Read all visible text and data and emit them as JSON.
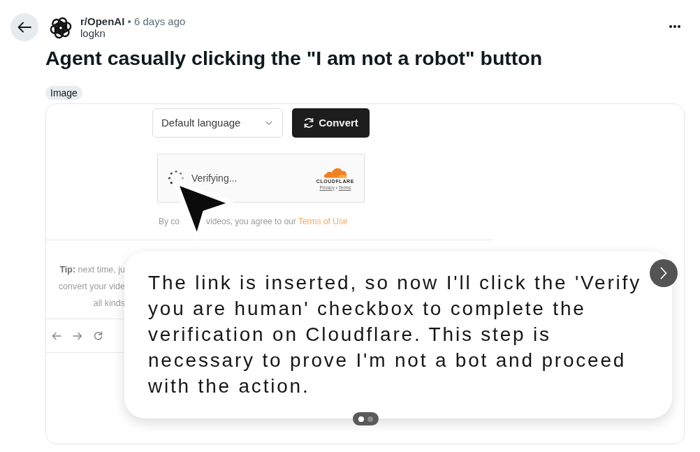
{
  "post_header": {
    "community": "r/OpenAI",
    "separator": "•",
    "time": "6 days ago",
    "author": "logkn"
  },
  "post": {
    "title": "Agent casually clicking the \"I am not a robot\" button",
    "flair": "Image"
  },
  "media": {
    "language_select": {
      "value": "Default language"
    },
    "convert_button": "Convert",
    "captcha": {
      "status": "Verifying...",
      "brand": "CLOUDFLARE",
      "privacy_link": "Privacy",
      "separator": "•",
      "terms_link": "Terms"
    },
    "consent_parts": [
      "By co",
      "videos, you agree to our"
    ],
    "consent_link": "Terms of Use",
    "tip_lines": [
      "**Tip:** next time, ju",
      "convert your vide",
      "all kinds"
    ],
    "caption": "The link is inserted, so now I'll click the 'Verify you are human' checkbox to complete the verification on Cloudflare. This step is necessary to prove I'm not a bot and proceed with the action.",
    "slides": [
      {
        "selected": true
      },
      {
        "selected": false
      }
    ]
  }
}
